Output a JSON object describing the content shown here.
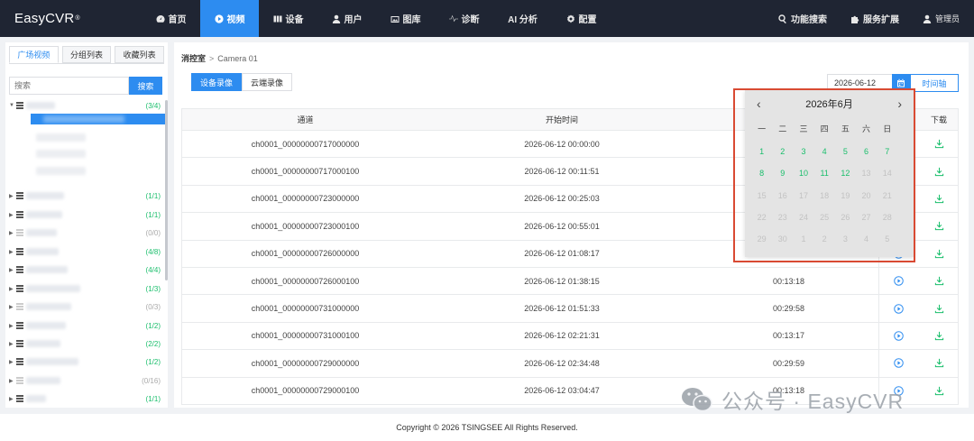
{
  "nav": {
    "brand": "EasyCVR",
    "brand_mark": "®",
    "items": [
      {
        "label": "首页",
        "icon": "dashboard-icon"
      },
      {
        "label": "视频",
        "icon": "play-circle-icon",
        "active": true
      },
      {
        "label": "设备",
        "icon": "device-icon"
      },
      {
        "label": "用户",
        "icon": "user-icon"
      },
      {
        "label": "图库",
        "icon": "gallery-icon"
      },
      {
        "label": "诊断",
        "icon": "pulse-icon"
      },
      {
        "label": "AI 分析",
        "icon": ""
      },
      {
        "label": "配置",
        "icon": "gear-icon"
      }
    ],
    "right": {
      "search": "功能搜索",
      "extend": "服务扩展",
      "user": "管理员"
    },
    "accent": "#2d8cf0"
  },
  "left": {
    "tabs": [
      "广场视频",
      "分组列表",
      "收藏列表"
    ],
    "search_placeholder": "搜索",
    "search_button": "搜索",
    "counts": [
      "(3/4)",
      "(1/1)",
      "(1/1)",
      "(0/0)",
      "(4/8)",
      "(4/4)",
      "(1/3)",
      "(0/3)",
      "(1/2)",
      "(2/2)",
      "(1/2)",
      "(0/16)",
      "(1/1)"
    ]
  },
  "main": {
    "breadcrumb_root": "消控室",
    "breadcrumb_sep": ">",
    "breadcrumb_camera": "Camera 01",
    "tabs": [
      "设备录像",
      "云端录像"
    ],
    "date": "2026-06-12",
    "timeline_button": "时间轴",
    "columns": {
      "channel": "通道",
      "start": "开始时间",
      "download": "下载"
    },
    "rows": [
      {
        "channel": "ch0001_00000000717000000",
        "start": "2026-06-12 00:00:00",
        "duration": ""
      },
      {
        "channel": "ch0001_00000000717000100",
        "start": "2026-06-12 00:11:51",
        "duration": ""
      },
      {
        "channel": "ch0001_00000000723000000",
        "start": "2026-06-12 00:25:03",
        "duration": ""
      },
      {
        "channel": "ch0001_00000000723000100",
        "start": "2026-06-12 00:55:01",
        "duration": ""
      },
      {
        "channel": "ch0001_00000000726000000",
        "start": "2026-06-12 01:08:17",
        "duration": ""
      },
      {
        "channel": "ch0001_00000000726000100",
        "start": "2026-06-12 01:38:15",
        "duration": "00:13:18"
      },
      {
        "channel": "ch0001_00000000731000000",
        "start": "2026-06-12 01:51:33",
        "duration": "00:29:58"
      },
      {
        "channel": "ch0001_00000000731000100",
        "start": "2026-06-12 02:21:31",
        "duration": "00:13:17"
      },
      {
        "channel": "ch0001_00000000729000000",
        "start": "2026-06-12 02:34:48",
        "duration": "00:29:59"
      },
      {
        "channel": "ch0001_00000000729000100",
        "start": "2026-06-12 03:04:47",
        "duration": "00:13:18"
      }
    ]
  },
  "calendar": {
    "title": "2026年6月",
    "weekdays": [
      "一",
      "二",
      "三",
      "四",
      "五",
      "六",
      "日"
    ],
    "weeks": [
      [
        {
          "d": "1",
          "on": true
        },
        {
          "d": "2",
          "on": true
        },
        {
          "d": "3",
          "on": true
        },
        {
          "d": "4",
          "on": true
        },
        {
          "d": "5",
          "on": true
        },
        {
          "d": "6",
          "on": true
        },
        {
          "d": "7",
          "on": true
        }
      ],
      [
        {
          "d": "8",
          "on": true
        },
        {
          "d": "9",
          "on": true
        },
        {
          "d": "10",
          "on": true
        },
        {
          "d": "11",
          "on": true
        },
        {
          "d": "12",
          "on": true
        },
        {
          "d": "13",
          "on": false
        },
        {
          "d": "14",
          "on": false
        }
      ],
      [
        {
          "d": "15",
          "on": false
        },
        {
          "d": "16",
          "on": false
        },
        {
          "d": "17",
          "on": false
        },
        {
          "d": "18",
          "on": false
        },
        {
          "d": "19",
          "on": false
        },
        {
          "d": "20",
          "on": false
        },
        {
          "d": "21",
          "on": false
        }
      ],
      [
        {
          "d": "22",
          "on": false
        },
        {
          "d": "23",
          "on": false
        },
        {
          "d": "24",
          "on": false
        },
        {
          "d": "25",
          "on": false
        },
        {
          "d": "26",
          "on": false
        },
        {
          "d": "27",
          "on": false
        },
        {
          "d": "28",
          "on": false
        }
      ],
      [
        {
          "d": "29",
          "on": false
        },
        {
          "d": "30",
          "on": false
        },
        {
          "d": "1",
          "on": false
        },
        {
          "d": "2",
          "on": false
        },
        {
          "d": "3",
          "on": false
        },
        {
          "d": "4",
          "on": false
        },
        {
          "d": "5",
          "on": false
        }
      ]
    ],
    "available_color": "#19be6b",
    "highlight_color": "#d94a33"
  },
  "footer": "Copyright © 2026 TSINGSEE All Rights Reserved.",
  "watermark": "公众号 · EasyCVR"
}
